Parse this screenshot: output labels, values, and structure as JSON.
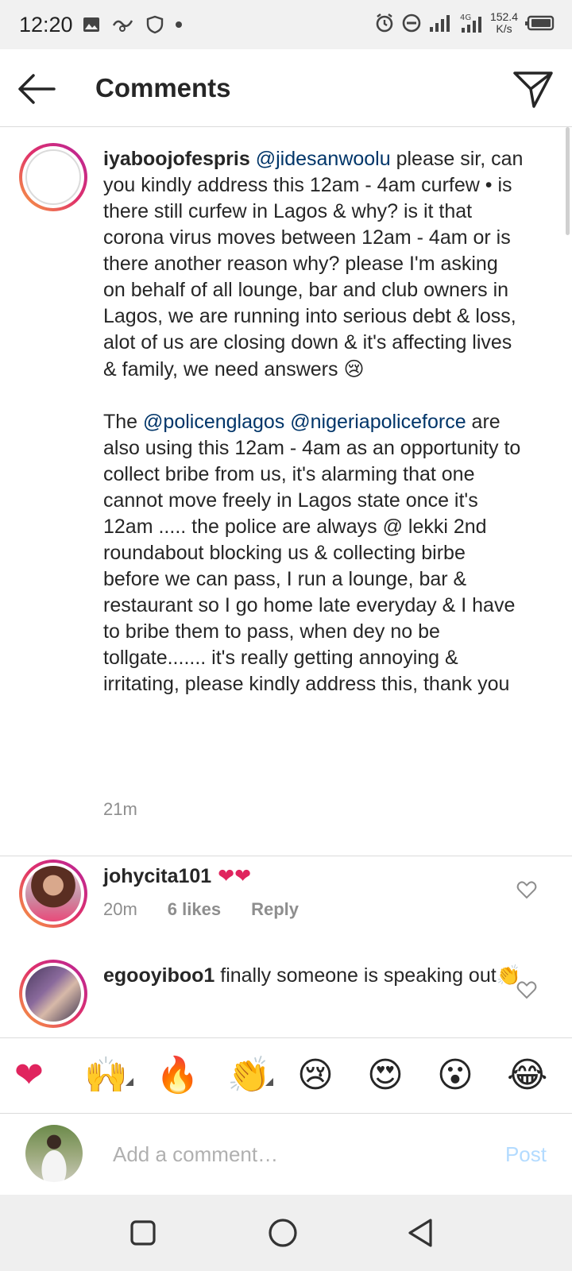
{
  "status_bar": {
    "time": "12:20",
    "speed_value": "152.4",
    "speed_unit": "K/s",
    "network": "4G"
  },
  "header": {
    "title": "Comments"
  },
  "caption": {
    "username": "iyaboojofespris",
    "mention_1": "@jidesanwoolu",
    "text_1": " please sir, can you kindly address this 12am - 4am curfew • is there still curfew in Lagos & why? is it that corona virus moves between 12am - 4am or is there another reason why? please I'm asking on behalf of all lounge, bar and club owners in Lagos, we are running into serious debt & loss, alot of us are closing down & it's affecting lives & family, we need answers ",
    "emoji_1": "😢",
    "para2_prefix": "The ",
    "mention_2": "@policenglagos",
    "mention_3": "@nigeriapoliceforce",
    "text_2": " are also using this 12am - 4am as an opportunity to collect bribe from us, it's alarming that one cannot move freely in Lagos state once it's 12am ..... the police are always @ lekki 2nd roundabout blocking us & collecting birbe before we can pass, I run a lounge, bar & restaurant so I go home late everyday & I have to bribe them to pass, when dey no be tollgate....... it's really getting annoying & irritating, please kindly address this, thank you",
    "time": "21m"
  },
  "comments": [
    {
      "username": "johycita101",
      "text": " ❤❤",
      "time": "20m",
      "likes": "6 likes",
      "reply": "Reply"
    },
    {
      "username": "egooyiboo1",
      "text": " finally someone is speaking out👏"
    }
  ],
  "emoji_bar": [
    "❤",
    "🙌",
    "🔥",
    "👏",
    "😢",
    "😍",
    "😮",
    "😂"
  ],
  "composer": {
    "placeholder": "Add a comment…",
    "post_label": "Post"
  },
  "colors": {
    "mention": "#003569",
    "post_disabled": "#b3dbff",
    "secondary_text": "#8e8e8e"
  }
}
